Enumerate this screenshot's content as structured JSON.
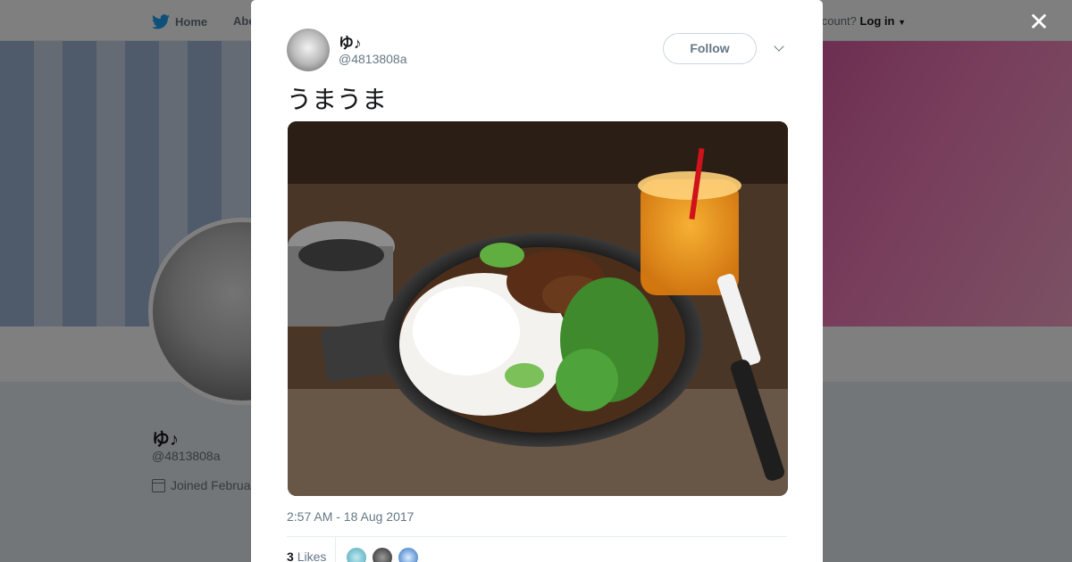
{
  "background": {
    "nav": {
      "home": "Home",
      "about": "Abo",
      "account_prompt": "ccount?",
      "login": "Log in"
    },
    "profile": {
      "name": "ゆ♪",
      "handle": "@4813808a",
      "joined": "Joined Februa"
    }
  },
  "modal": {
    "close_label": "✕",
    "author": {
      "name": "ゆ♪",
      "handle": "@4813808a"
    },
    "follow_label": "Follow",
    "text": "うまうま",
    "media_alt": "Curry with rice and greens in a skillet, with a glass of orange juice and a knife",
    "timestamp": "2:57 AM - 18 Aug 2017",
    "likes": {
      "count": "3",
      "label": "Likes"
    }
  },
  "colors": {
    "accent": "#1da1f2",
    "text_secondary": "#657786"
  }
}
